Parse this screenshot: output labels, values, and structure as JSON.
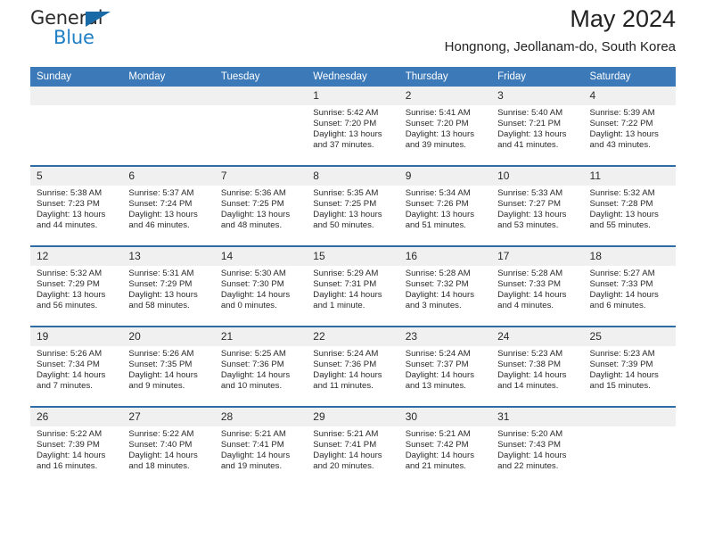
{
  "brand": {
    "name_top": "General",
    "name_bottom": "Blue",
    "triangle_color": "#1a6aa8",
    "blue_color": "#1f7fc4"
  },
  "header": {
    "title": "May 2024",
    "location": "Hongnong, Jeollanam-do, South Korea"
  },
  "theme": {
    "header_row_bg": "#3b79b8",
    "week_separator": "#2f6ca4",
    "daynum_bg": "#f0f0f0",
    "cell_bg": "#ffffff",
    "text": "#2a2a2a"
  },
  "calendar": {
    "weekday_headers": [
      "Sunday",
      "Monday",
      "Tuesday",
      "Wednesday",
      "Thursday",
      "Friday",
      "Saturday"
    ],
    "labels": {
      "sunrise": "Sunrise:",
      "sunset": "Sunset:",
      "daylight": "Daylight:"
    },
    "weeks": [
      [
        {
          "day": "",
          "empty": true,
          "sunrise": "",
          "sunset": "",
          "daylight_line1": "",
          "daylight_line2": ""
        },
        {
          "day": "",
          "empty": true,
          "sunrise": "",
          "sunset": "",
          "daylight_line1": "",
          "daylight_line2": ""
        },
        {
          "day": "",
          "empty": true,
          "sunrise": "",
          "sunset": "",
          "daylight_line1": "",
          "daylight_line2": ""
        },
        {
          "day": "1",
          "empty": false,
          "sunrise": "Sunrise: 5:42 AM",
          "sunset": "Sunset: 7:20 PM",
          "daylight_line1": "Daylight: 13 hours",
          "daylight_line2": "and 37 minutes."
        },
        {
          "day": "2",
          "empty": false,
          "sunrise": "Sunrise: 5:41 AM",
          "sunset": "Sunset: 7:20 PM",
          "daylight_line1": "Daylight: 13 hours",
          "daylight_line2": "and 39 minutes."
        },
        {
          "day": "3",
          "empty": false,
          "sunrise": "Sunrise: 5:40 AM",
          "sunset": "Sunset: 7:21 PM",
          "daylight_line1": "Daylight: 13 hours",
          "daylight_line2": "and 41 minutes."
        },
        {
          "day": "4",
          "empty": false,
          "sunrise": "Sunrise: 5:39 AM",
          "sunset": "Sunset: 7:22 PM",
          "daylight_line1": "Daylight: 13 hours",
          "daylight_line2": "and 43 minutes."
        }
      ],
      [
        {
          "day": "5",
          "empty": false,
          "sunrise": "Sunrise: 5:38 AM",
          "sunset": "Sunset: 7:23 PM",
          "daylight_line1": "Daylight: 13 hours",
          "daylight_line2": "and 44 minutes."
        },
        {
          "day": "6",
          "empty": false,
          "sunrise": "Sunrise: 5:37 AM",
          "sunset": "Sunset: 7:24 PM",
          "daylight_line1": "Daylight: 13 hours",
          "daylight_line2": "and 46 minutes."
        },
        {
          "day": "7",
          "empty": false,
          "sunrise": "Sunrise: 5:36 AM",
          "sunset": "Sunset: 7:25 PM",
          "daylight_line1": "Daylight: 13 hours",
          "daylight_line2": "and 48 minutes."
        },
        {
          "day": "8",
          "empty": false,
          "sunrise": "Sunrise: 5:35 AM",
          "sunset": "Sunset: 7:25 PM",
          "daylight_line1": "Daylight: 13 hours",
          "daylight_line2": "and 50 minutes."
        },
        {
          "day": "9",
          "empty": false,
          "sunrise": "Sunrise: 5:34 AM",
          "sunset": "Sunset: 7:26 PM",
          "daylight_line1": "Daylight: 13 hours",
          "daylight_line2": "and 51 minutes."
        },
        {
          "day": "10",
          "empty": false,
          "sunrise": "Sunrise: 5:33 AM",
          "sunset": "Sunset: 7:27 PM",
          "daylight_line1": "Daylight: 13 hours",
          "daylight_line2": "and 53 minutes."
        },
        {
          "day": "11",
          "empty": false,
          "sunrise": "Sunrise: 5:32 AM",
          "sunset": "Sunset: 7:28 PM",
          "daylight_line1": "Daylight: 13 hours",
          "daylight_line2": "and 55 minutes."
        }
      ],
      [
        {
          "day": "12",
          "empty": false,
          "sunrise": "Sunrise: 5:32 AM",
          "sunset": "Sunset: 7:29 PM",
          "daylight_line1": "Daylight: 13 hours",
          "daylight_line2": "and 56 minutes."
        },
        {
          "day": "13",
          "empty": false,
          "sunrise": "Sunrise: 5:31 AM",
          "sunset": "Sunset: 7:29 PM",
          "daylight_line1": "Daylight: 13 hours",
          "daylight_line2": "and 58 minutes."
        },
        {
          "day": "14",
          "empty": false,
          "sunrise": "Sunrise: 5:30 AM",
          "sunset": "Sunset: 7:30 PM",
          "daylight_line1": "Daylight: 14 hours",
          "daylight_line2": "and 0 minutes."
        },
        {
          "day": "15",
          "empty": false,
          "sunrise": "Sunrise: 5:29 AM",
          "sunset": "Sunset: 7:31 PM",
          "daylight_line1": "Daylight: 14 hours",
          "daylight_line2": "and 1 minute."
        },
        {
          "day": "16",
          "empty": false,
          "sunrise": "Sunrise: 5:28 AM",
          "sunset": "Sunset: 7:32 PM",
          "daylight_line1": "Daylight: 14 hours",
          "daylight_line2": "and 3 minutes."
        },
        {
          "day": "17",
          "empty": false,
          "sunrise": "Sunrise: 5:28 AM",
          "sunset": "Sunset: 7:33 PM",
          "daylight_line1": "Daylight: 14 hours",
          "daylight_line2": "and 4 minutes."
        },
        {
          "day": "18",
          "empty": false,
          "sunrise": "Sunrise: 5:27 AM",
          "sunset": "Sunset: 7:33 PM",
          "daylight_line1": "Daylight: 14 hours",
          "daylight_line2": "and 6 minutes."
        }
      ],
      [
        {
          "day": "19",
          "empty": false,
          "sunrise": "Sunrise: 5:26 AM",
          "sunset": "Sunset: 7:34 PM",
          "daylight_line1": "Daylight: 14 hours",
          "daylight_line2": "and 7 minutes."
        },
        {
          "day": "20",
          "empty": false,
          "sunrise": "Sunrise: 5:26 AM",
          "sunset": "Sunset: 7:35 PM",
          "daylight_line1": "Daylight: 14 hours",
          "daylight_line2": "and 9 minutes."
        },
        {
          "day": "21",
          "empty": false,
          "sunrise": "Sunrise: 5:25 AM",
          "sunset": "Sunset: 7:36 PM",
          "daylight_line1": "Daylight: 14 hours",
          "daylight_line2": "and 10 minutes."
        },
        {
          "day": "22",
          "empty": false,
          "sunrise": "Sunrise: 5:24 AM",
          "sunset": "Sunset: 7:36 PM",
          "daylight_line1": "Daylight: 14 hours",
          "daylight_line2": "and 11 minutes."
        },
        {
          "day": "23",
          "empty": false,
          "sunrise": "Sunrise: 5:24 AM",
          "sunset": "Sunset: 7:37 PM",
          "daylight_line1": "Daylight: 14 hours",
          "daylight_line2": "and 13 minutes."
        },
        {
          "day": "24",
          "empty": false,
          "sunrise": "Sunrise: 5:23 AM",
          "sunset": "Sunset: 7:38 PM",
          "daylight_line1": "Daylight: 14 hours",
          "daylight_line2": "and 14 minutes."
        },
        {
          "day": "25",
          "empty": false,
          "sunrise": "Sunrise: 5:23 AM",
          "sunset": "Sunset: 7:39 PM",
          "daylight_line1": "Daylight: 14 hours",
          "daylight_line2": "and 15 minutes."
        }
      ],
      [
        {
          "day": "26",
          "empty": false,
          "sunrise": "Sunrise: 5:22 AM",
          "sunset": "Sunset: 7:39 PM",
          "daylight_line1": "Daylight: 14 hours",
          "daylight_line2": "and 16 minutes."
        },
        {
          "day": "27",
          "empty": false,
          "sunrise": "Sunrise: 5:22 AM",
          "sunset": "Sunset: 7:40 PM",
          "daylight_line1": "Daylight: 14 hours",
          "daylight_line2": "and 18 minutes."
        },
        {
          "day": "28",
          "empty": false,
          "sunrise": "Sunrise: 5:21 AM",
          "sunset": "Sunset: 7:41 PM",
          "daylight_line1": "Daylight: 14 hours",
          "daylight_line2": "and 19 minutes."
        },
        {
          "day": "29",
          "empty": false,
          "sunrise": "Sunrise: 5:21 AM",
          "sunset": "Sunset: 7:41 PM",
          "daylight_line1": "Daylight: 14 hours",
          "daylight_line2": "and 20 minutes."
        },
        {
          "day": "30",
          "empty": false,
          "sunrise": "Sunrise: 5:21 AM",
          "sunset": "Sunset: 7:42 PM",
          "daylight_line1": "Daylight: 14 hours",
          "daylight_line2": "and 21 minutes."
        },
        {
          "day": "31",
          "empty": false,
          "sunrise": "Sunrise: 5:20 AM",
          "sunset": "Sunset: 7:43 PM",
          "daylight_line1": "Daylight: 14 hours",
          "daylight_line2": "and 22 minutes."
        },
        {
          "day": "",
          "empty": true,
          "sunrise": "",
          "sunset": "",
          "daylight_line1": "",
          "daylight_line2": ""
        }
      ]
    ]
  }
}
